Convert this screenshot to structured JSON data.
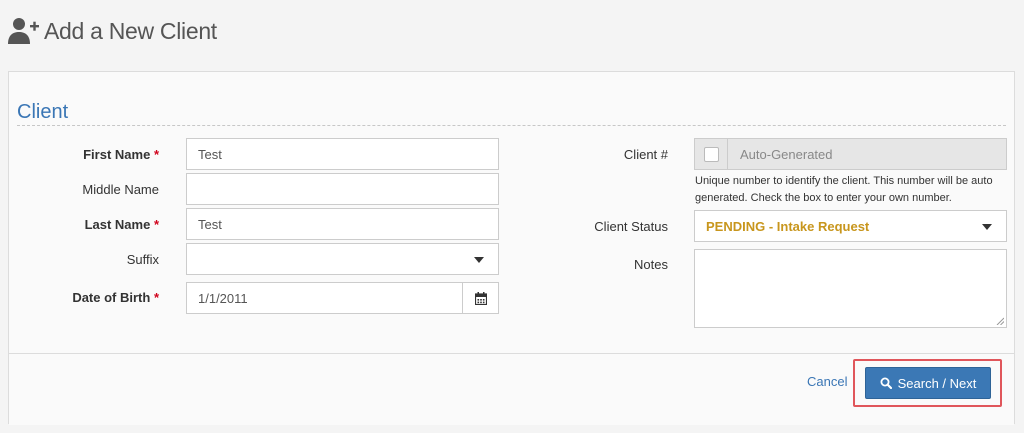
{
  "header": {
    "title": "Add a New Client",
    "icon": "user-plus-icon"
  },
  "section": {
    "title": "Client"
  },
  "fields": {
    "first_name": {
      "label": "First Name",
      "required": "*",
      "value": "Test"
    },
    "middle_name": {
      "label": "Middle Name",
      "value": ""
    },
    "last_name": {
      "label": "Last Name",
      "required": "*",
      "value": "Test"
    },
    "suffix": {
      "label": "Suffix",
      "value": ""
    },
    "dob": {
      "label": "Date of Birth",
      "required": "*",
      "value": "1/1/2011",
      "icon": "calendar-icon"
    },
    "client_num": {
      "label": "Client #",
      "value": "Auto-Generated",
      "help": "Unique number to identify the client. This number will be auto generated. Check the box to enter your own number."
    },
    "client_status": {
      "label": "Client Status",
      "value": "PENDING - Intake Request",
      "color": "#c8961d"
    },
    "notes": {
      "label": "Notes",
      "value": ""
    }
  },
  "footer": {
    "cancel_label": "Cancel",
    "submit_label": "Search / Next",
    "submit_icon": "search-icon"
  },
  "colors": {
    "accent": "#3a76b5",
    "required": "#d0021b",
    "highlight": "#e0565b"
  }
}
